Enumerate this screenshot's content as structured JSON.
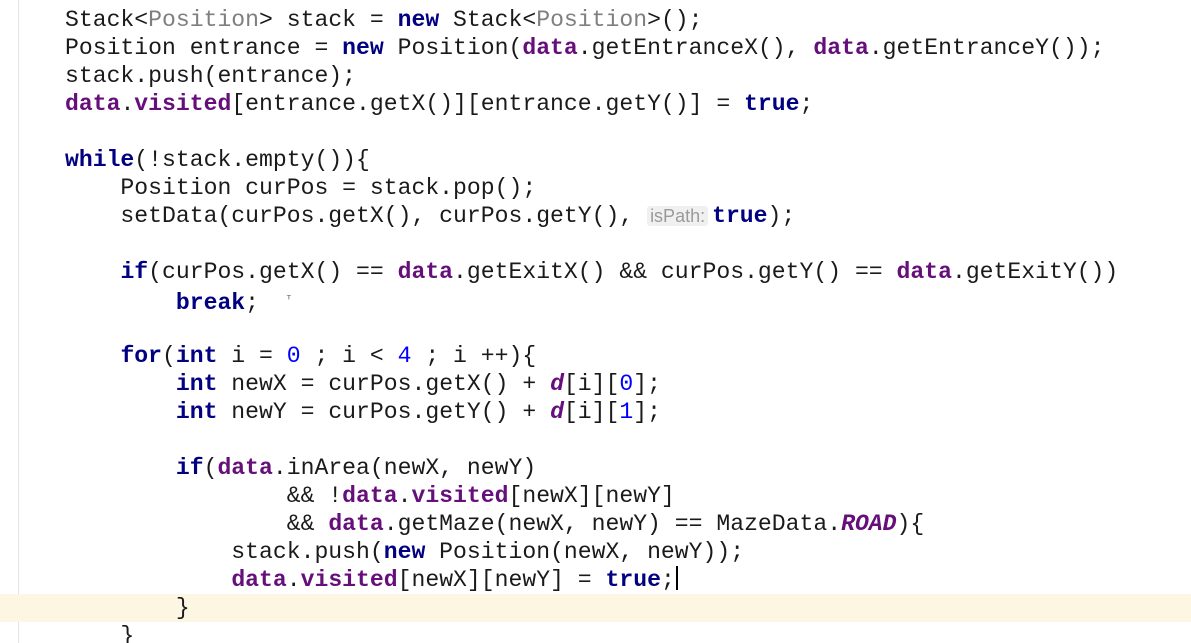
{
  "editor": {
    "language": "Java",
    "current_line_index": 21,
    "lines": [
      [
        {
          "t": "Stack<"
        },
        {
          "t": "Position",
          "c": "gen"
        },
        {
          "t": "> stack = "
        },
        {
          "t": "new",
          "c": "kw"
        },
        {
          "t": " Stack<"
        },
        {
          "t": "Position",
          "c": "gen"
        },
        {
          "t": ">();"
        }
      ],
      [
        {
          "t": "Position entrance = "
        },
        {
          "t": "new",
          "c": "kw"
        },
        {
          "t": " Position("
        },
        {
          "t": "data",
          "c": "fld"
        },
        {
          "t": ".getEntranceX(), "
        },
        {
          "t": "data",
          "c": "fld"
        },
        {
          "t": ".getEntranceY());"
        }
      ],
      [
        {
          "t": "stack.push(entrance);"
        }
      ],
      [
        {
          "t": "data",
          "c": "fld"
        },
        {
          "t": "."
        },
        {
          "t": "visited",
          "c": "fld"
        },
        {
          "t": "[entrance.getX()][entrance.getY()] = "
        },
        {
          "t": "true",
          "c": "kw"
        },
        {
          "t": ";"
        }
      ],
      [],
      [
        {
          "t": "while",
          "c": "kw"
        },
        {
          "t": "(!stack.empty()){"
        }
      ],
      [
        {
          "t": "    Position curPos = stack.pop();"
        }
      ],
      [
        {
          "t": "    setData(curPos.getX(), curPos.getY(), "
        },
        {
          "t": "isPath:",
          "c": "hint"
        },
        {
          "t": "true",
          "c": "kw"
        },
        {
          "t": ");"
        }
      ],
      [],
      [
        {
          "t": "    "
        },
        {
          "t": "if",
          "c": "kw"
        },
        {
          "t": "(curPos.getX() == "
        },
        {
          "t": "data",
          "c": "fld"
        },
        {
          "t": ".getExitX() && curPos.getY() == "
        },
        {
          "t": "data",
          "c": "fld"
        },
        {
          "t": ".getExitY())"
        }
      ],
      [
        {
          "t": "        "
        },
        {
          "t": "break",
          "c": "kw"
        },
        {
          "t": ";  "
        },
        {
          "t": "ᵀ",
          "c": "mouse"
        }
      ],
      [],
      [
        {
          "t": "    "
        },
        {
          "t": "for",
          "c": "kw"
        },
        {
          "t": "("
        },
        {
          "t": "int",
          "c": "kw"
        },
        {
          "t": " i = "
        },
        {
          "t": "0",
          "c": "num"
        },
        {
          "t": " ; i < "
        },
        {
          "t": "4",
          "c": "num"
        },
        {
          "t": " ; i ++){"
        }
      ],
      [
        {
          "t": "        "
        },
        {
          "t": "int",
          "c": "kw"
        },
        {
          "t": " newX = curPos.getX() + "
        },
        {
          "t": "d",
          "c": "var"
        },
        {
          "t": "[i]["
        },
        {
          "t": "0",
          "c": "num"
        },
        {
          "t": "];"
        }
      ],
      [
        {
          "t": "        "
        },
        {
          "t": "int",
          "c": "kw"
        },
        {
          "t": " newY = curPos.getY() + "
        },
        {
          "t": "d",
          "c": "var"
        },
        {
          "t": "[i]["
        },
        {
          "t": "1",
          "c": "num"
        },
        {
          "t": "];"
        }
      ],
      [],
      [
        {
          "t": "        "
        },
        {
          "t": "if",
          "c": "kw"
        },
        {
          "t": "("
        },
        {
          "t": "data",
          "c": "fld"
        },
        {
          "t": ".inArea(newX, newY)"
        }
      ],
      [
        {
          "t": "                && !"
        },
        {
          "t": "data",
          "c": "fld"
        },
        {
          "t": "."
        },
        {
          "t": "visited",
          "c": "fld"
        },
        {
          "t": "[newX][newY]"
        }
      ],
      [
        {
          "t": "                && "
        },
        {
          "t": "data",
          "c": "fld"
        },
        {
          "t": ".getMaze(newX, newY) == MazeData."
        },
        {
          "t": "ROAD",
          "c": "var"
        },
        {
          "t": "){"
        }
      ],
      [
        {
          "t": "            stack.push("
        },
        {
          "t": "new",
          "c": "kw"
        },
        {
          "t": " Position(newX, newY));"
        }
      ],
      [
        {
          "t": "            "
        },
        {
          "t": "data",
          "c": "fld"
        },
        {
          "t": "."
        },
        {
          "t": "visited",
          "c": "fld"
        },
        {
          "t": "[newX][newY] = "
        },
        {
          "t": "true",
          "c": "kw"
        },
        {
          "t": ";"
        },
        {
          "t": "",
          "c": "caret"
        }
      ],
      [
        {
          "t": "        }"
        }
      ],
      [
        {
          "t": "    }"
        }
      ]
    ]
  }
}
